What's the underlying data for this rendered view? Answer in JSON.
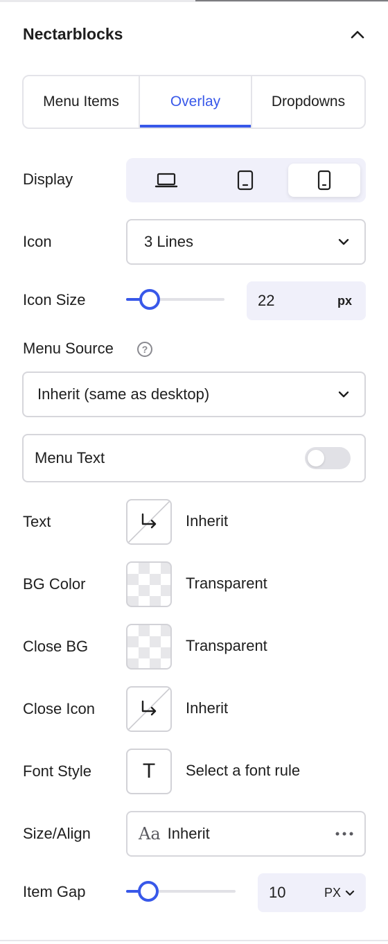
{
  "panel": {
    "title": "Nectarblocks",
    "collapse_icon": "chevron-up-icon"
  },
  "tabs": [
    {
      "label": "Menu Items",
      "active": false
    },
    {
      "label": "Overlay",
      "active": true
    },
    {
      "label": "Dropdowns",
      "active": false
    }
  ],
  "accent_color": "#3858e9",
  "display": {
    "label": "Display",
    "devices": [
      {
        "icon": "laptop-icon",
        "active": false
      },
      {
        "icon": "tablet-icon",
        "active": false
      },
      {
        "icon": "phone-icon",
        "active": true
      }
    ]
  },
  "icon": {
    "label": "Icon",
    "value": "3 Lines",
    "dropdown_icon": "chevron-down-icon"
  },
  "icon_size": {
    "label": "Icon Size",
    "value": "22",
    "unit": "px",
    "slider_fraction": 0.2
  },
  "menu_source": {
    "label": "Menu Source",
    "help_icon": "question-circle-icon",
    "help_glyph": "?",
    "value": "Inherit (same as desktop)"
  },
  "menu_text": {
    "label": "Menu Text",
    "enabled": false
  },
  "colors": [
    {
      "label": "Text",
      "value": "Inherit",
      "swatch": "inherit"
    },
    {
      "label": "BG Color",
      "value": "Transparent",
      "swatch": "transparent"
    },
    {
      "label": "Close BG",
      "value": "Transparent",
      "swatch": "transparent"
    },
    {
      "label": "Close Icon",
      "value": "Inherit",
      "swatch": "inherit"
    }
  ],
  "font_style": {
    "label": "Font Style",
    "glyph": "T",
    "value": "Select a font rule"
  },
  "size_align": {
    "label": "Size/Align",
    "glyph": "Aa",
    "value": "Inherit",
    "more_icon": "more-horizontal-icon"
  },
  "item_gap": {
    "label": "Item Gap",
    "value": "10",
    "unit": "PX",
    "slider_fraction": 0.21
  }
}
